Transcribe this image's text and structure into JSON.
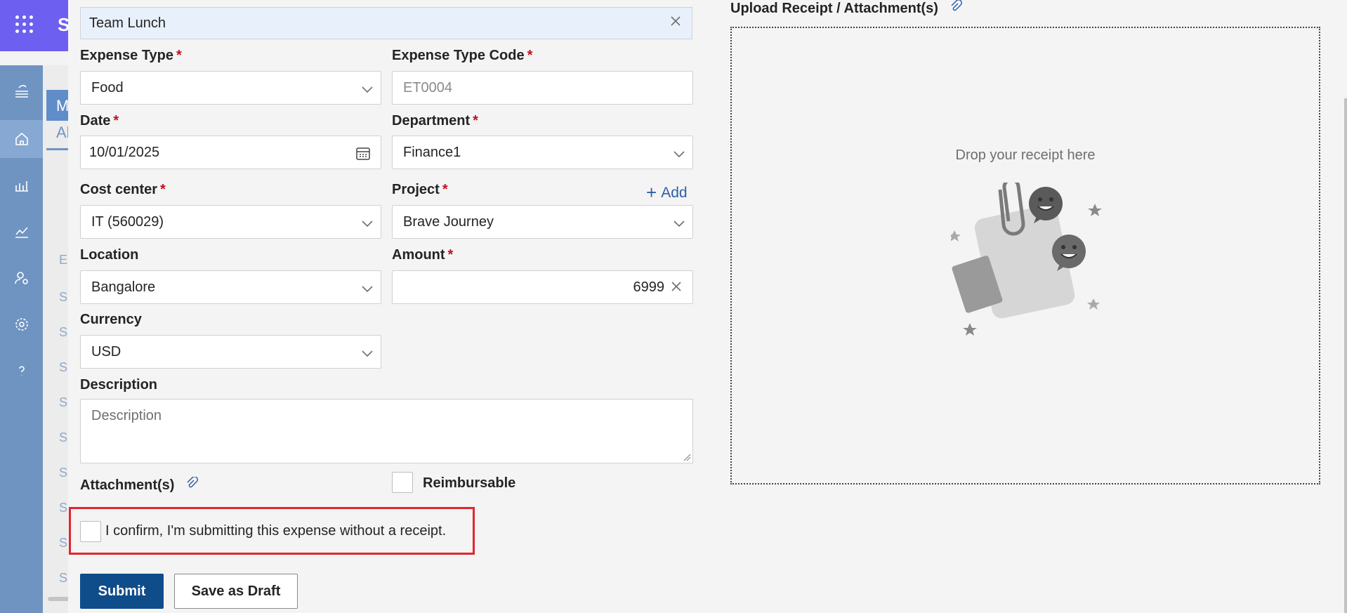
{
  "topbar": {
    "letter": "S"
  },
  "background_list": {
    "header_letter": "M",
    "tab_letter": "Al",
    "rows": [
      "E",
      "S",
      "S",
      "S",
      "S",
      "S",
      "S",
      "S",
      "S",
      "S",
      "S"
    ]
  },
  "rail": {
    "items": [
      "menu-icon",
      "home-icon",
      "reports-icon",
      "trend-icon",
      "user-settings-icon",
      "settings-icon",
      "help-icon"
    ]
  },
  "form": {
    "title_value": "Team Lunch",
    "expense_type": {
      "label": "Expense Type",
      "value": "Food"
    },
    "expense_type_code": {
      "label": "Expense Type Code",
      "placeholder": "ET0004"
    },
    "date": {
      "label": "Date",
      "value": "10/01/2025"
    },
    "department": {
      "label": "Department",
      "value": "Finance1"
    },
    "cost_center": {
      "label": "Cost center",
      "value": "IT (560029)"
    },
    "project": {
      "label": "Project",
      "value": "Brave Journey",
      "add_label": "Add"
    },
    "location": {
      "label": "Location",
      "value": "Bangalore"
    },
    "amount": {
      "label": "Amount",
      "value": "6999"
    },
    "currency": {
      "label": "Currency",
      "value": "USD"
    },
    "description": {
      "label": "Description",
      "placeholder": "Description"
    },
    "attachments_label": "Attachment(s)",
    "reimbursable_label": "Reimbursable",
    "confirm_label": "I confirm, I'm submitting this expense without a receipt.",
    "required_marker": "*"
  },
  "buttons": {
    "submit": "Submit",
    "save_draft": "Save as Draft"
  },
  "upload": {
    "title": "Upload Receipt / Attachment(s)",
    "drop_text": "Drop your receipt here"
  },
  "colors": {
    "topbar": "#6d5ff0",
    "rail": "#6f94c2",
    "primary_button": "#0f4c8a",
    "highlight_border": "#e1252e",
    "required": "#c50f1f",
    "link": "#2b5fa8"
  }
}
